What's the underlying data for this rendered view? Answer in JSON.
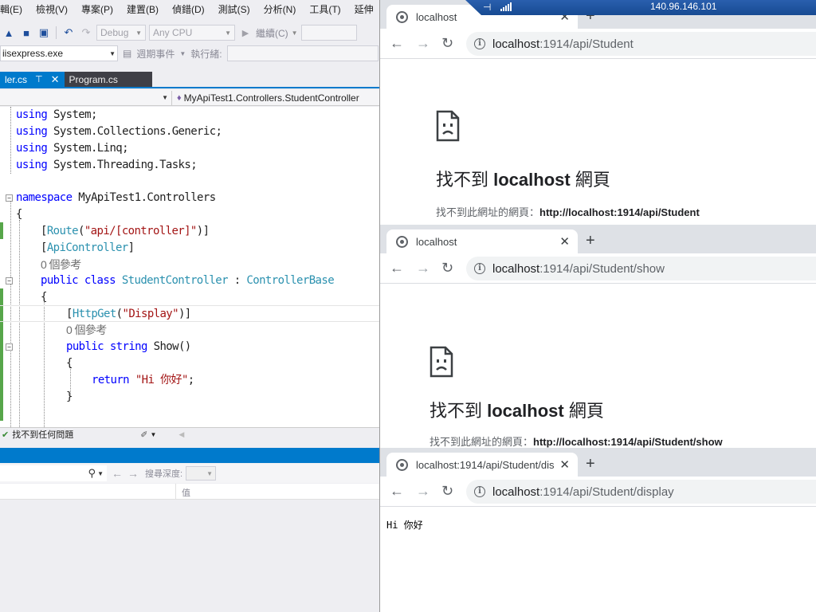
{
  "vs": {
    "menu": [
      "輯(E)",
      "檢視(V)",
      "專案(P)",
      "建置(B)",
      "偵錯(D)",
      "測試(S)",
      "分析(N)",
      "工具(T)",
      "延伸"
    ],
    "toolbar": {
      "config": "Debug",
      "platform": "Any CPU",
      "continue_label": "繼續(C)"
    },
    "toolbar2": {
      "process": "iisexpress.exe",
      "lifecycle_events": "週期事件",
      "thread_label": "執行緒:"
    },
    "tabs": [
      {
        "label": "ler.cs",
        "active": true
      },
      {
        "label": "Program.cs",
        "active": false
      }
    ],
    "nav_class": "MyApiTest1.Controllers.StudentController",
    "code": {
      "l1": [
        "using",
        " System;"
      ],
      "l2": [
        "using",
        " System.Collections.Generic;"
      ],
      "l3": [
        "using",
        " System.Linq;"
      ],
      "l4": [
        "using",
        " System.Threading.Tasks;"
      ],
      "l6": [
        "namespace",
        " MyApiTest1.Controllers"
      ],
      "l7": "{",
      "l8": [
        "[",
        "Route",
        "(",
        "\"api/[controller]\"",
        ")]"
      ],
      "l9": [
        "[",
        "ApiController",
        "]"
      ],
      "l10": "0 個參考",
      "l11": [
        "public",
        " ",
        "class",
        " ",
        "StudentController",
        " : ",
        "ControllerBase"
      ],
      "l12": "{",
      "l13": [
        "[",
        "HttpGet",
        "(",
        "\"Display\"",
        ")]"
      ],
      "l14": "0 個參考",
      "l15": [
        "public",
        " ",
        "string",
        " Show()"
      ],
      "l16": "{",
      "l17": [
        "return",
        " ",
        "\"Hi 你好\"",
        ";"
      ],
      "l18": "}"
    },
    "status": "找不到任何問題",
    "watch": {
      "search_depth_label": "搜尋深度:",
      "value_column": "值"
    }
  },
  "rdp": {
    "ip": "140.96.146.101"
  },
  "chrome": [
    {
      "tab_title": "localhost",
      "url_host": "localhost",
      "url_rest": ":1914/api/Student",
      "error_title_pre": "找不到 ",
      "error_title_host": "localhost",
      "error_title_post": " 網頁",
      "error_sub_label": "找不到此網址的網頁：",
      "error_sub_url": "http://localhost:1914/api/Student"
    },
    {
      "tab_title": "localhost",
      "url_host": "localhost",
      "url_rest": ":1914/api/Student/show",
      "error_title_pre": "找不到 ",
      "error_title_host": "localhost",
      "error_title_post": " 網頁",
      "error_sub_label": "找不到此網址的網頁：",
      "error_sub_url": "http://localhost:1914/api/Student/show"
    },
    {
      "tab_title": "localhost:1914/api/Student/dis",
      "url_host": "localhost",
      "url_rest": ":1914/api/Student/display",
      "body_text": "Hi 你好"
    }
  ],
  "icons": {
    "browser_back": "arrow-left-icon",
    "browser_forward": "arrow-right-icon",
    "browser_reload": "reload-icon",
    "site_info": "info-icon",
    "page_error": "sad-page-icon"
  },
  "colors": {
    "vs_accent": "#007acc",
    "keyword": "#0000ff",
    "string": "#a31515",
    "type": "#2b91af",
    "change_bar": "#57a64a",
    "chrome_tabstrip": "#dee1e6"
  }
}
